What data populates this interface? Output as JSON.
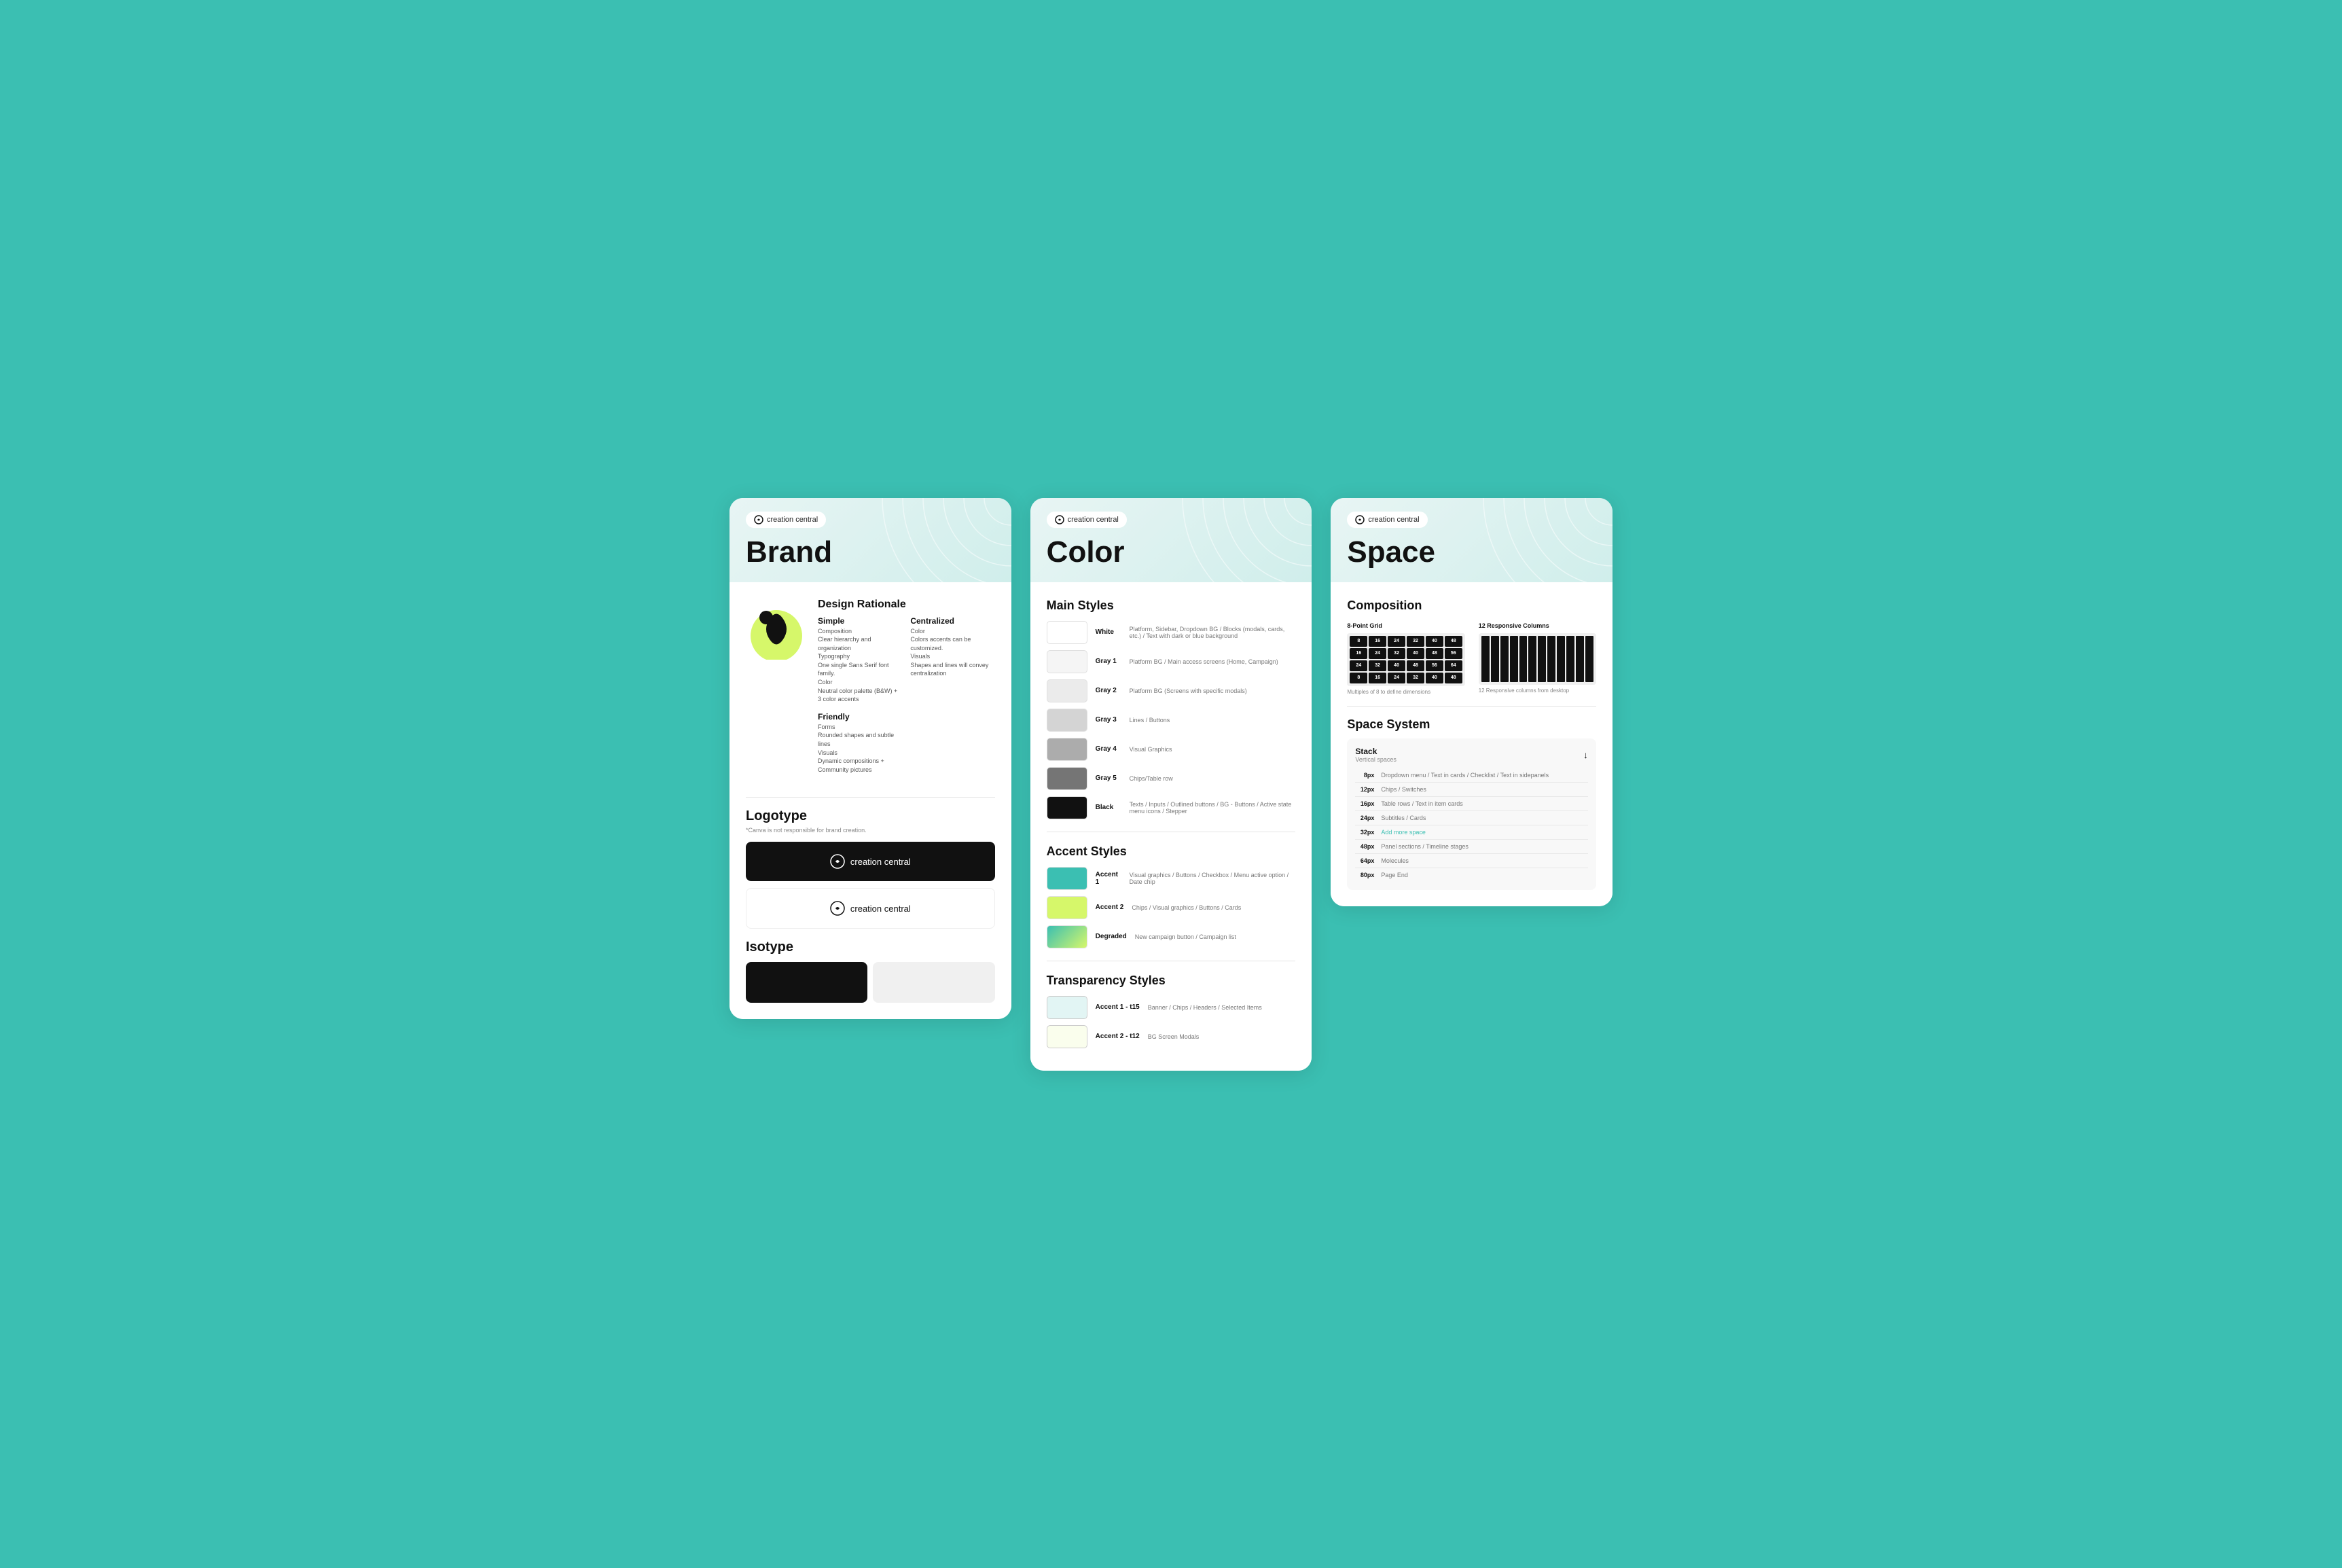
{
  "brand_panel": {
    "pill_label": "creation central",
    "title": "Brand",
    "design_rationale": "Design Rationale",
    "dr_items": [
      {
        "title": "Simple",
        "sub": "Composition\nClear hierarchy and organization\nTypography\nOne single Sans Serif font family.\nColor\nNeutral color palette (B&W) + 3 color accents"
      },
      {
        "title": "Centralized",
        "sub": "Color\nColors accents can be customized.\nVisuals\nShapes and lines will convey centralization"
      },
      {
        "title": "Friendly",
        "sub": "Forms\nRounded shapes and subtle lines\nVisuals\nDynamic compositions + Community pictures"
      }
    ],
    "logotype_title": "Logotype",
    "logotype_sub": "*Canva is not responsible for brand creation.",
    "logo_dark_text": "creation central",
    "logo_light_text": "creation central",
    "isotype_title": "Isotype"
  },
  "color_panel": {
    "pill_label": "creation central",
    "title": "Color",
    "main_styles_title": "Main Styles",
    "main_styles": [
      {
        "label": "White",
        "desc": "Platform, Sidebar, Dropdown BG / Blocks (modals, cards, etc.) / Text with dark or blue background",
        "color": "#ffffff"
      },
      {
        "label": "Gray 1",
        "desc": "Platform BG / Main access screens (Home, Campaign)",
        "color": "#f5f5f5"
      },
      {
        "label": "Gray 2",
        "desc": "Platform BG (Screens with specific modals)",
        "color": "#ebebeb"
      },
      {
        "label": "Gray 3",
        "desc": "Lines / Buttons",
        "color": "#d4d4d4"
      },
      {
        "label": "Gray 4",
        "desc": "Visual Graphics",
        "color": "#acacac"
      },
      {
        "label": "Gray 5",
        "desc": "Chips/Table row",
        "color": "#757575"
      },
      {
        "label": "Black",
        "desc": "Texts / Inputs / Outlined buttons / BG - Buttons / Active state menu icons / Stepper",
        "color": "#111111"
      }
    ],
    "accent_styles_title": "Accent Styles",
    "accent_styles": [
      {
        "label": "Accent 1",
        "desc": "Visual graphics / Buttons / Checkbox / Menu active option / Date chip",
        "color": "#3bbfb2"
      },
      {
        "label": "Accent 2",
        "desc": "Chips / Visual graphics / Buttons / Cards",
        "color": "#d6f76a"
      },
      {
        "label": "Degraded",
        "desc": "New campaign button / Campaign list",
        "gradient": true
      }
    ],
    "transparency_title": "Transparency Styles",
    "transparency_styles": [
      {
        "label": "Accent 1 - t15",
        "desc": "Banner / Chips / Headers / Selected Items",
        "color": "rgba(59,191,178,0.15)"
      },
      {
        "label": "Accent 2 - t12",
        "desc": "BG Screen Modals",
        "color": "rgba(214,247,106,0.12)"
      }
    ]
  },
  "space_panel": {
    "pill_label": "creation central",
    "title": "Space",
    "composition_title": "Composition",
    "grid_8pt_label": "8-Point Grid",
    "grid_8pt_sub": "Multiples of 8 to define dimensions",
    "grid_12col_label": "12 Responsive Columns",
    "grid_12col_sub": "12 Responsive columns from desktop",
    "grid_values": [
      "8",
      "16",
      "24",
      "32",
      "40",
      "16",
      "24",
      "32",
      "40",
      "48",
      "24",
      "32",
      "40",
      "48",
      "56",
      "32",
      "40",
      "48",
      "56",
      "64",
      "8",
      "16",
      "24",
      "32",
      "40"
    ],
    "space_system_title": "Space System",
    "stack_title": "Stack",
    "stack_sub": "Vertical spaces",
    "space_rows": [
      {
        "px": "8px",
        "desc": "Dropdown menu / Text in cards / Checklist / Text in sidepanels"
      },
      {
        "px": "12px",
        "desc": "Chips / Switches"
      },
      {
        "px": "16px",
        "desc": "Table rows / Text in item cards"
      },
      {
        "px": "24px",
        "desc": "Subtitles / Cards"
      },
      {
        "px": "32px",
        "desc": "Add more space",
        "highlight": true
      },
      {
        "px": "48px",
        "desc": "Panel sections / Timeline stages"
      },
      {
        "px": "64px",
        "desc": "Molecules"
      },
      {
        "px": "80px",
        "desc": "Page End"
      }
    ]
  }
}
